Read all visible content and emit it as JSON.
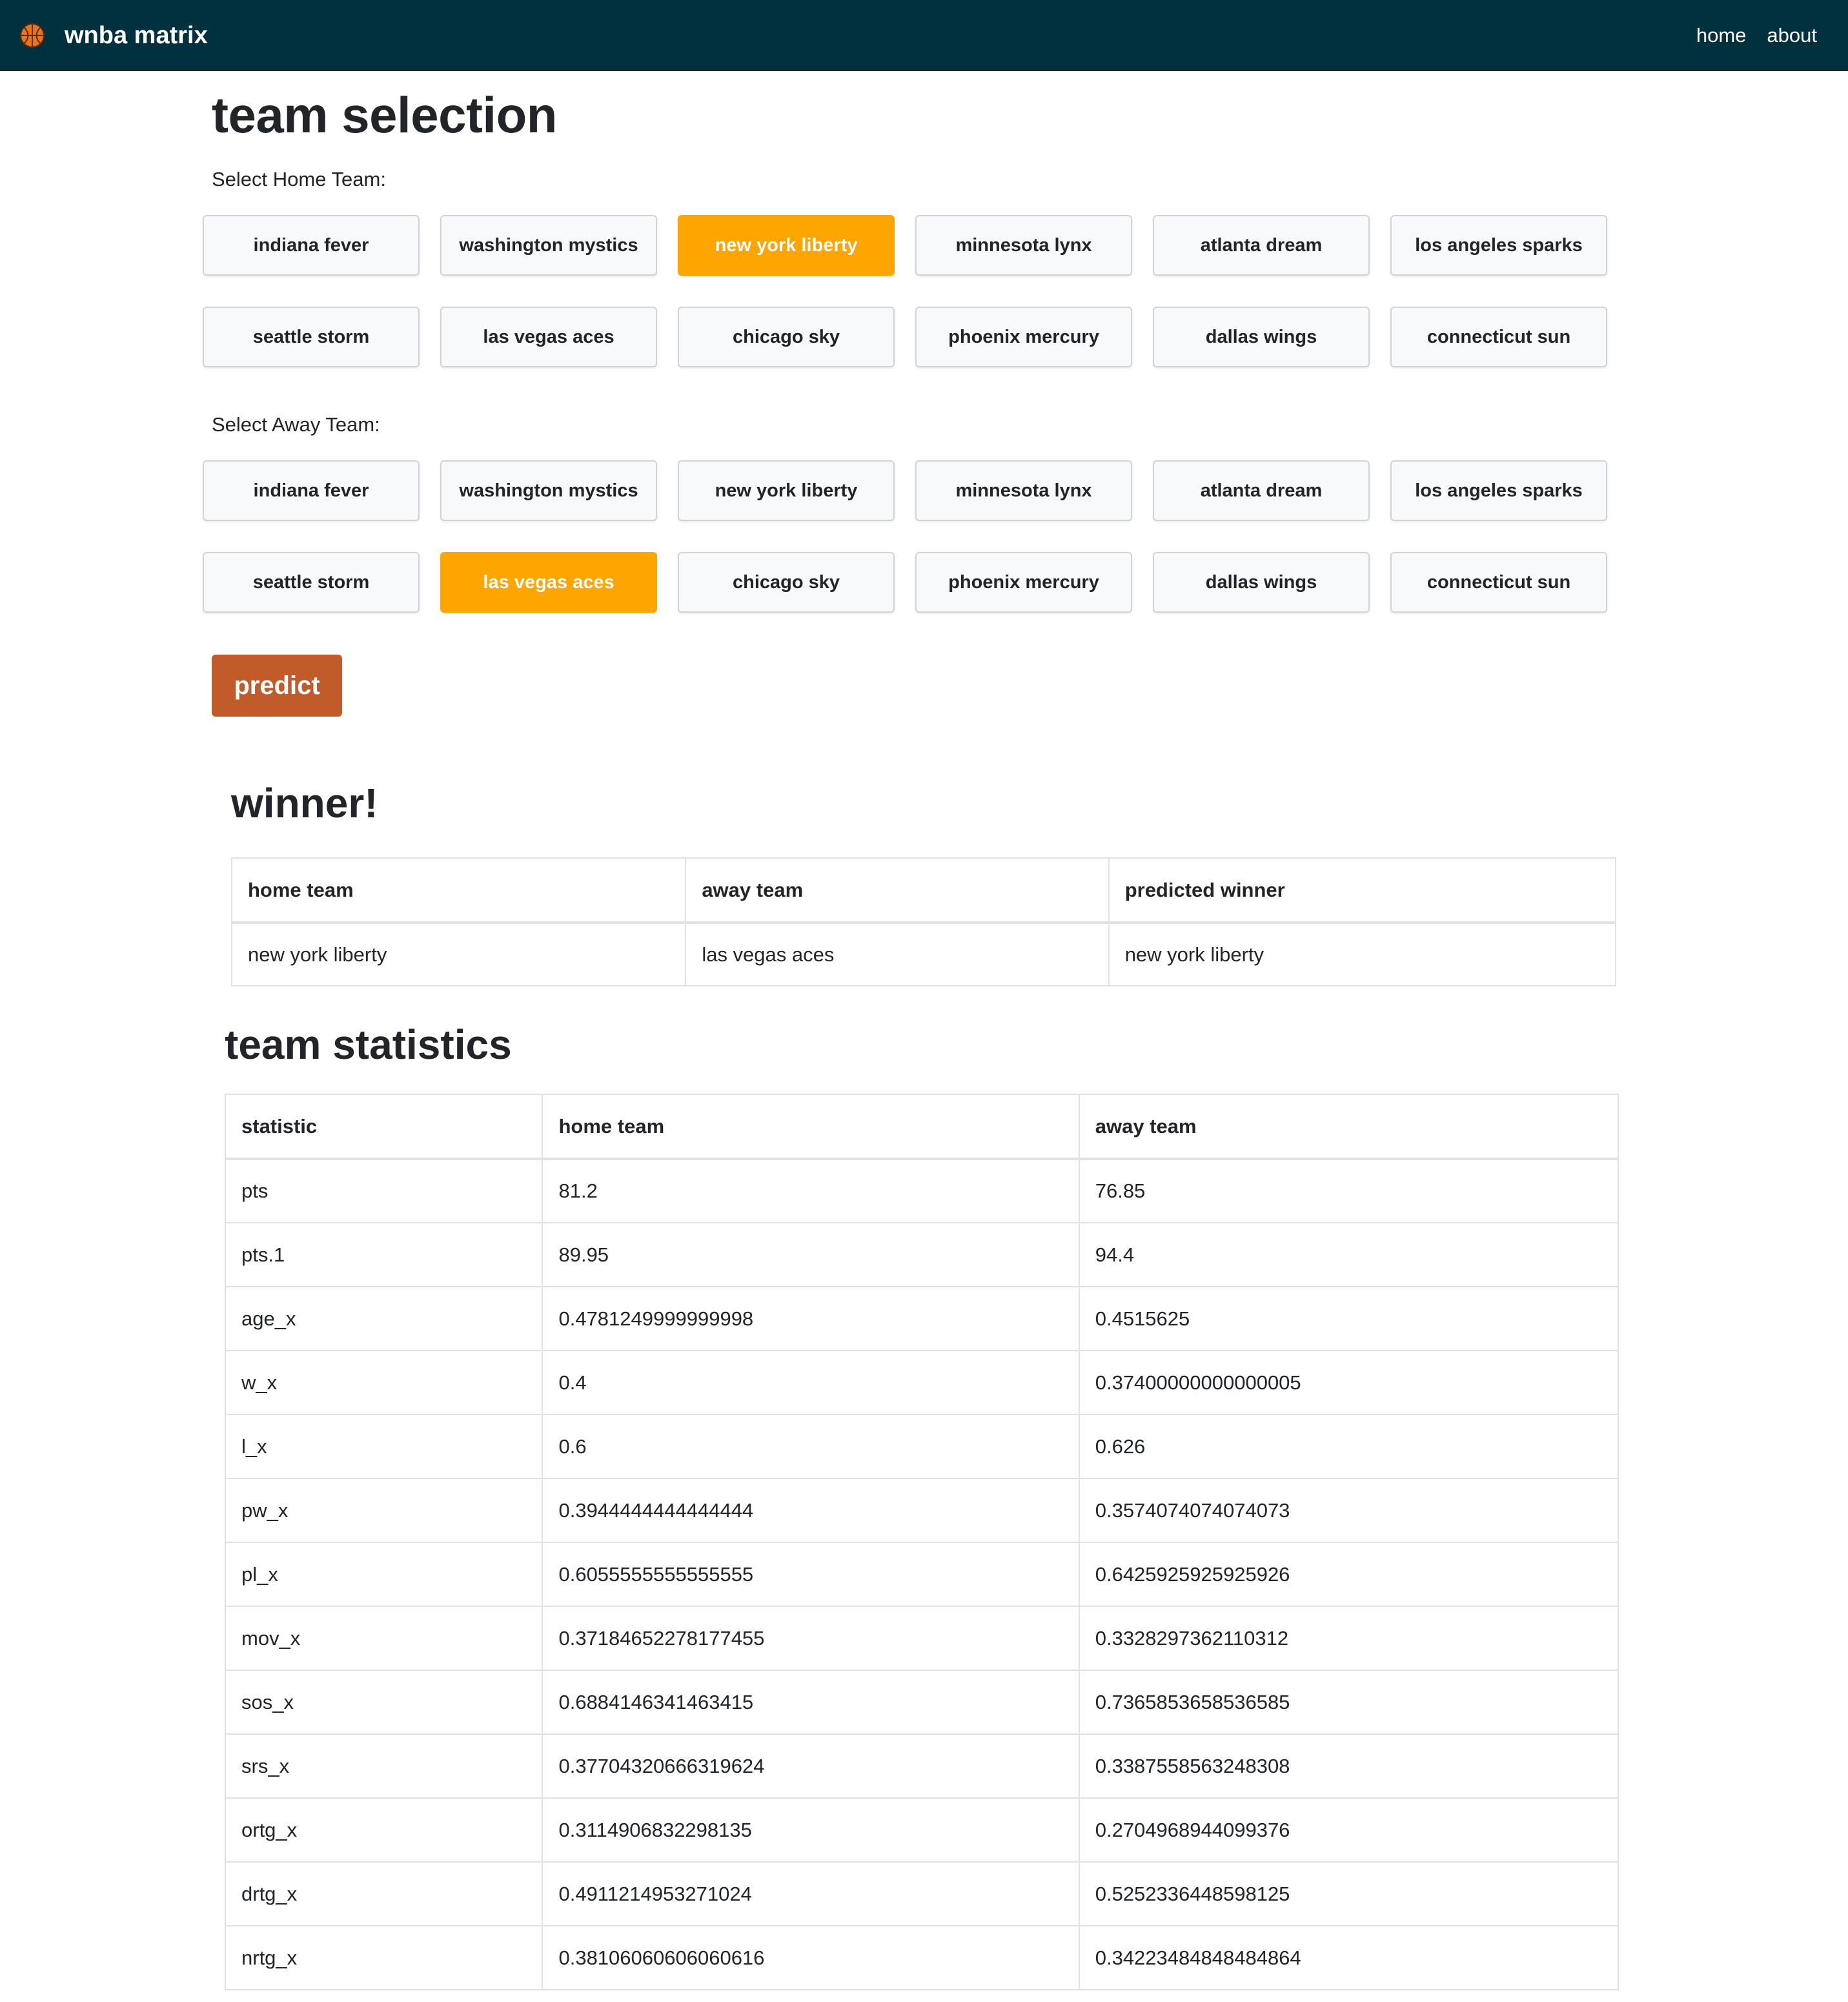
{
  "navbar": {
    "brand_icon": "basketball-icon",
    "brand": "wnba matrix",
    "links": [
      "home",
      "about"
    ]
  },
  "page_title": "team selection",
  "home_label": "Select Home Team:",
  "away_label": "Select Away Team:",
  "teams": [
    "indiana fever",
    "washington mystics",
    "new york liberty",
    "minnesota lynx",
    "atlanta dream",
    "los angeles sparks",
    "seattle storm",
    "las vegas aces",
    "chicago sky",
    "phoenix mercury",
    "dallas wings",
    "connecticut sun"
  ],
  "selected_home": "new york liberty",
  "selected_away": "las vegas aces",
  "selected_color": "#ffa500",
  "predict_label": "predict",
  "predict_color": "#c15b2a",
  "winner": {
    "title": "winner!",
    "headers": [
      "home team",
      "away team",
      "predicted winner"
    ],
    "row": [
      "new york liberty",
      "las vegas aces",
      "new york liberty"
    ]
  },
  "stats": {
    "title": "team statistics",
    "headers": [
      "statistic",
      "home team",
      "away team"
    ],
    "rows": [
      [
        "pts",
        "81.2",
        "76.85"
      ],
      [
        "pts.1",
        "89.95",
        "94.4"
      ],
      [
        "age_x",
        "0.4781249999999998",
        "0.4515625"
      ],
      [
        "w_x",
        "0.4",
        "0.37400000000000005"
      ],
      [
        "l_x",
        "0.6",
        "0.626"
      ],
      [
        "pw_x",
        "0.3944444444444444",
        "0.3574074074074073"
      ],
      [
        "pl_x",
        "0.6055555555555555",
        "0.6425925925925926"
      ],
      [
        "mov_x",
        "0.37184652278177455",
        "0.3328297362110312"
      ],
      [
        "sos_x",
        "0.6884146341463415",
        "0.7365853658536585"
      ],
      [
        "srs_x",
        "0.37704320666319624",
        "0.3387558563248308"
      ],
      [
        "ortg_x",
        "0.3114906832298135",
        "0.2704968944099376"
      ],
      [
        "drtg_x",
        "0.4911214953271024",
        "0.5252336448598125"
      ],
      [
        "nrtg_x",
        "0.38106060606060616",
        "0.34223484848484864"
      ]
    ]
  }
}
